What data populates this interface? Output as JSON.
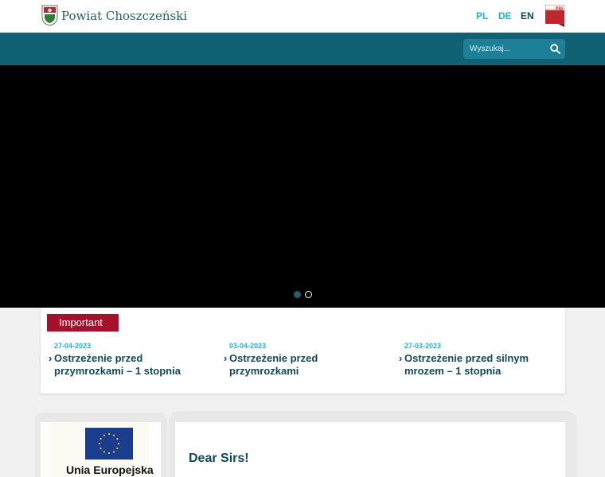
{
  "header": {
    "logo_text": "Powiat Choszczeński",
    "languages": [
      "PL",
      "DE",
      "EN"
    ],
    "bip_label": "bip"
  },
  "search": {
    "placeholder": "Wyszukaj..."
  },
  "important": {
    "label": "Important",
    "items": [
      {
        "date": "27-04-2023",
        "title": "Ostrzeżenie przed przymrozkami – 1 stopnia"
      },
      {
        "date": "03-04-2023",
        "title": "Ostrzeżenie przed przymrozkami"
      },
      {
        "date": "27-03-2023",
        "title": "Ostrzeżenie przed silnym mrozem – 1 stopnia"
      }
    ]
  },
  "eu": {
    "label": "Unia Europejska"
  },
  "main": {
    "greeting": "Dear Sirs!"
  },
  "colors": {
    "brand_teal": "#0f6173",
    "accent_cyan": "#1fb3d3",
    "important_red": "#a80f2b"
  }
}
